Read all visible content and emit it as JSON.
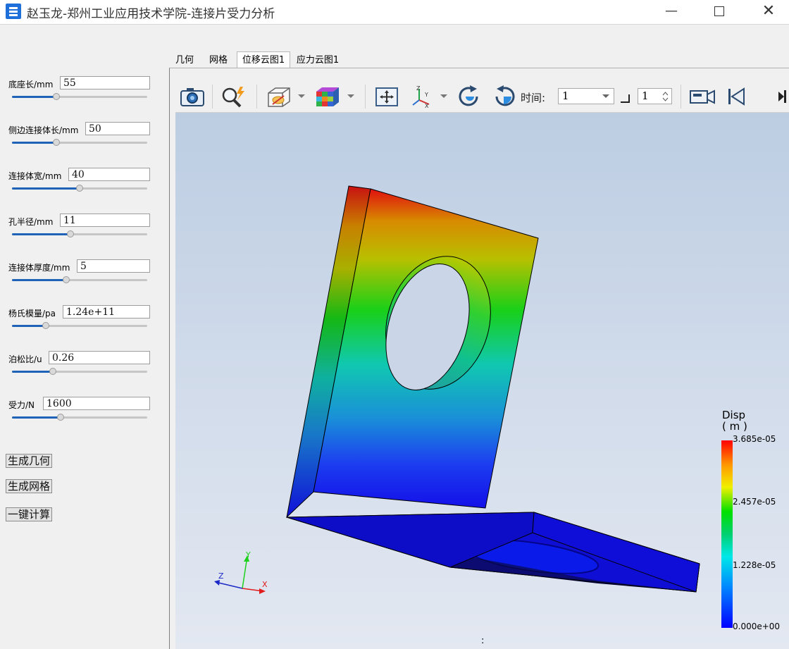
{
  "window": {
    "title": "赵玉龙-郑州工业应用技术学院-连接片受力分析",
    "minimize": "—",
    "close": "✕"
  },
  "params": [
    {
      "label": "底座长/mm",
      "value": "55",
      "slider_level": 0.33
    },
    {
      "label": "侧边连接体长/mm",
      "value": "50",
      "slider_level": 0.33
    },
    {
      "label": "连接体宽/mm",
      "value": "40",
      "slider_level": 0.5
    },
    {
      "label": "孔半径/mm",
      "value": "11",
      "slider_level": 0.43
    },
    {
      "label": "连接体厚度/mm",
      "value": "5",
      "slider_level": 0.4
    },
    {
      "label": "杨氏模量/pa",
      "value": "1.24e+11",
      "slider_level": 0.25
    },
    {
      "label": "泊松比/u",
      "value": "0.26",
      "slider_level": 0.3
    },
    {
      "label": "受力/N",
      "value": "1600",
      "slider_level": 0.36
    }
  ],
  "actions": {
    "gen_geometry": "生成几何",
    "gen_mesh": "生成网格",
    "compute": "一键计算"
  },
  "tabs": [
    "几何",
    "网格",
    "位移云图1",
    "应力云图1"
  ],
  "active_tab": "位移云图1",
  "toolbar": {
    "time_label": "时间:",
    "time_value": "1",
    "step_value": "1",
    "icons": [
      "camera-icon",
      "zoom-icon",
      "visibility-icon",
      "color-cube-icon",
      "fit-view-icon",
      "axes-icon",
      "rotate-cw-icon",
      "rotate-ccw-icon",
      "video-icon",
      "first-frame-icon",
      "last-frame-icon"
    ]
  },
  "legend": {
    "title": "Disp",
    "unit": "( m )",
    "max": "3.685e-05",
    "mid2": "2.457e-05",
    "mid1": "1.228e-05",
    "min": "0.000e+00",
    "colors": [
      "#ff0000",
      "#ffb000",
      "#e6e600",
      "#00e600",
      "#00e0e0",
      "#0066ff",
      "#0000ff"
    ]
  },
  "triad": {
    "x": "X",
    "y": "Y",
    "z": "Z"
  },
  "footer": ":"
}
